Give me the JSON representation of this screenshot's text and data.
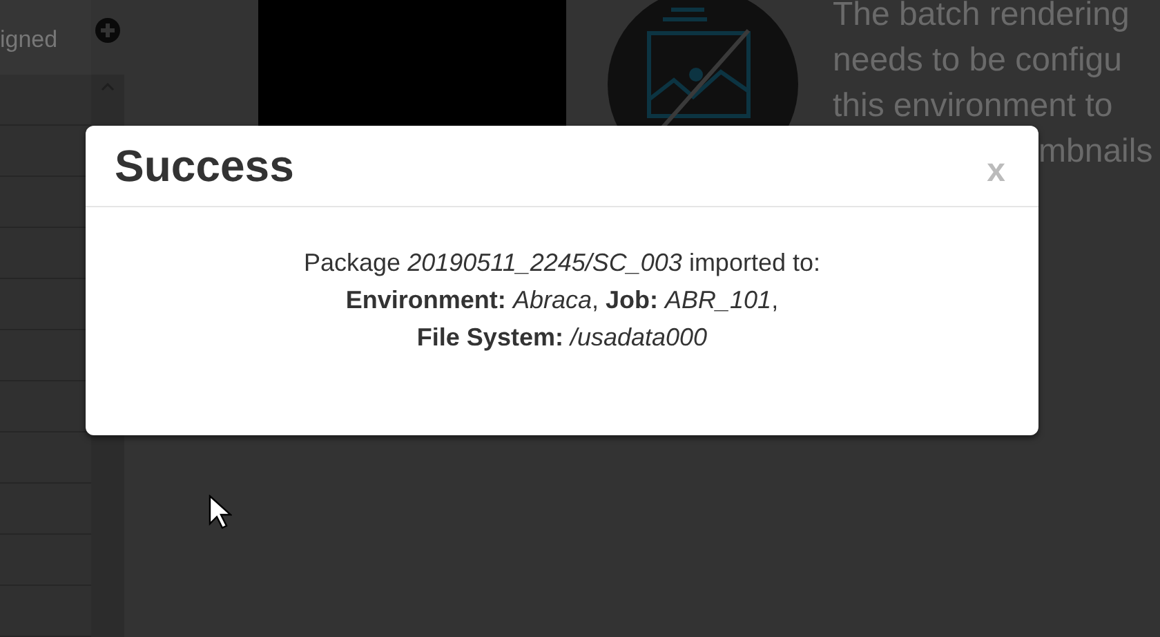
{
  "sidebar": {
    "header": "igned"
  },
  "background_text": {
    "lines": [
      "The batch rendering",
      "needs to be configu",
      "this environment to"
    ],
    "hidden_line": "mbnails"
  },
  "modal": {
    "title": "Success",
    "close": "x",
    "message": [
      "Package *20190511_2245/SC_003* imported to:",
      "**Environment:** *Abraca*, **Job:** *ABR_101*,",
      "**File System:** */usadata000*"
    ]
  }
}
